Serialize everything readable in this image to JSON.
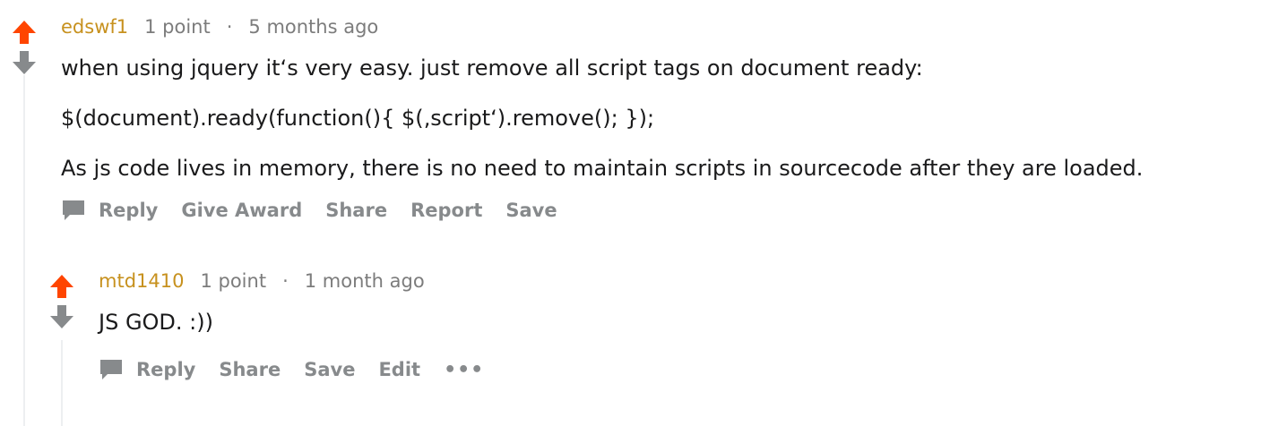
{
  "comments": [
    {
      "author": "edswf1",
      "points": "1 point",
      "separator": "·",
      "time": "5 months ago",
      "lines": [
        "when using jquery it‘s very easy. just remove all script tags on document ready:",
        "$(document).ready(function(){ $(‚script‘).remove(); });",
        "As js code lives in memory, there is no need to maintain scripts in sourcecode after they are loaded."
      ],
      "actions": [
        "Reply",
        "Give Award",
        "Share",
        "Report",
        "Save"
      ]
    },
    {
      "author": "mtd1410",
      "points": "1 point",
      "separator": "·",
      "time": "1 month ago",
      "lines": [
        "JS GOD. :))"
      ],
      "actions": [
        "Reply",
        "Share",
        "Save",
        "Edit"
      ],
      "more": "•••"
    }
  ],
  "colors": {
    "upvote": "#ff4500",
    "downvote": "#878a8c",
    "author": "#c7911e",
    "meta": "#7c7c7c",
    "action": "#878a8c",
    "thread_line": "#edeff1"
  },
  "icons": {
    "upvote": "upvote-arrow-icon",
    "downvote": "downvote-arrow-icon",
    "reply": "speech-bubble-icon"
  }
}
